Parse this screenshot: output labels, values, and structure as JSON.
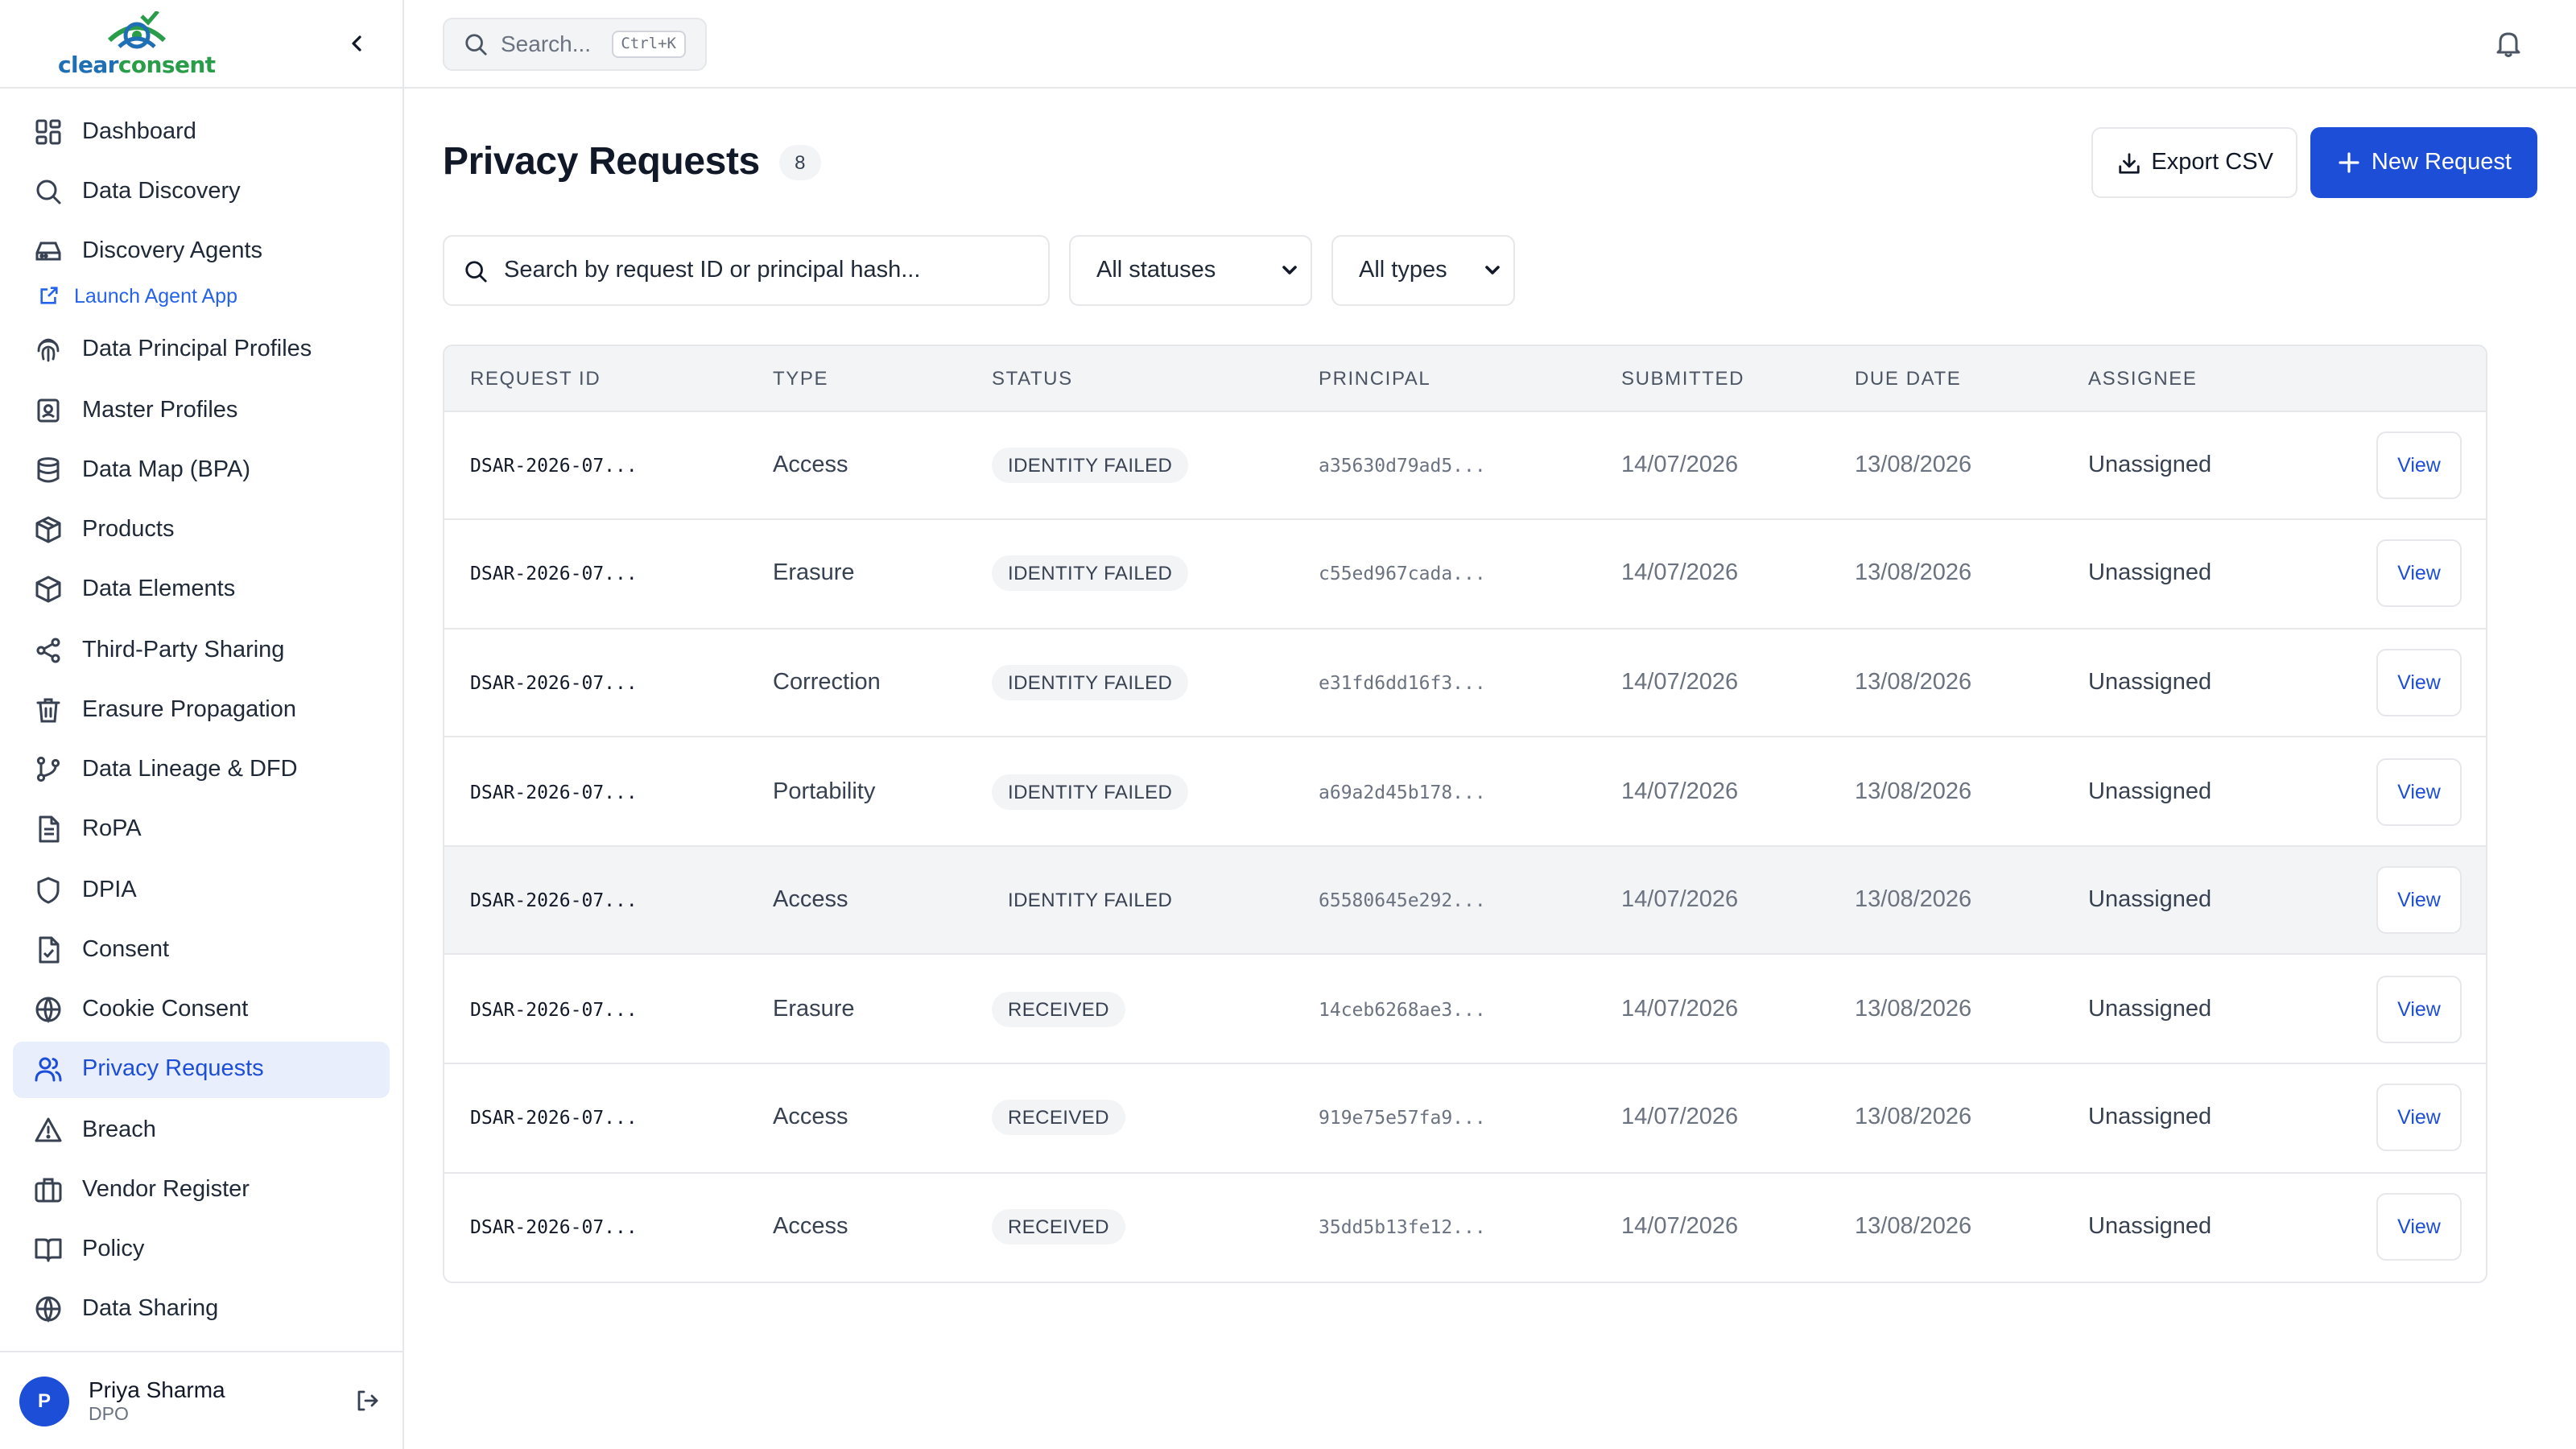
{
  "brand": {
    "name_part1": "clear",
    "name_part2": "consent",
    "primary": "#1d4ed8"
  },
  "sidebar": {
    "items": [
      {
        "label": "Dashboard",
        "icon": "dashboard-icon"
      },
      {
        "label": "Data Discovery",
        "icon": "search-icon"
      },
      {
        "label": "Discovery Agents",
        "icon": "hard-drive-icon"
      },
      {
        "label": "Data Principal Profiles",
        "icon": "fingerprint-icon"
      },
      {
        "label": "Master Profiles",
        "icon": "contact-icon"
      },
      {
        "label": "Data Map (BPA)",
        "icon": "database-icon"
      },
      {
        "label": "Products",
        "icon": "package-icon"
      },
      {
        "label": "Data Elements",
        "icon": "box-icon"
      },
      {
        "label": "Third-Party Sharing",
        "icon": "share-icon"
      },
      {
        "label": "Erasure Propagation",
        "icon": "trash-icon"
      },
      {
        "label": "Data Lineage & DFD",
        "icon": "git-branch-icon"
      },
      {
        "label": "RoPA",
        "icon": "file-text-icon"
      },
      {
        "label": "DPIA",
        "icon": "shield-icon"
      },
      {
        "label": "Consent",
        "icon": "file-check-icon"
      },
      {
        "label": "Cookie Consent",
        "icon": "globe-icon"
      },
      {
        "label": "Privacy Requests",
        "icon": "users-icon"
      },
      {
        "label": "Breach",
        "icon": "alert-triangle-icon"
      },
      {
        "label": "Vendor Register",
        "icon": "briefcase-icon"
      },
      {
        "label": "Policy",
        "icon": "book-icon"
      },
      {
        "label": "Data Sharing",
        "icon": "globe-icon"
      }
    ],
    "launch_agent_label": "Launch Agent App",
    "user": {
      "initial": "P",
      "name": "Priya Sharma",
      "role": "DPO"
    }
  },
  "topbar": {
    "search_label": "Search...",
    "shortcut": "Ctrl+K"
  },
  "page": {
    "title": "Privacy Requests",
    "count": "8",
    "export_label": "Export CSV",
    "new_label": "New Request"
  },
  "filters": {
    "search_placeholder": "Search by request ID or principal hash...",
    "status_selected": "All statuses",
    "type_selected": "All types"
  },
  "table": {
    "columns": [
      "REQUEST ID",
      "TYPE",
      "STATUS",
      "PRINCIPAL",
      "SUBMITTED",
      "DUE DATE",
      "ASSIGNEE"
    ],
    "action_label": "View",
    "rows": [
      {
        "id": "DSAR-2026-07...",
        "type": "Access",
        "status": "IDENTITY FAILED",
        "principal": "a35630d79ad5...",
        "submitted": "14/07/2026",
        "due": "13/08/2026",
        "assignee": "Unassigned"
      },
      {
        "id": "DSAR-2026-07...",
        "type": "Erasure",
        "status": "IDENTITY FAILED",
        "principal": "c55ed967cada...",
        "submitted": "14/07/2026",
        "due": "13/08/2026",
        "assignee": "Unassigned"
      },
      {
        "id": "DSAR-2026-07...",
        "type": "Correction",
        "status": "IDENTITY FAILED",
        "principal": "e31fd6dd16f3...",
        "submitted": "14/07/2026",
        "due": "13/08/2026",
        "assignee": "Unassigned"
      },
      {
        "id": "DSAR-2026-07...",
        "type": "Portability",
        "status": "IDENTITY FAILED",
        "principal": "a69a2d45b178...",
        "submitted": "14/07/2026",
        "due": "13/08/2026",
        "assignee": "Unassigned"
      },
      {
        "id": "DSAR-2026-07...",
        "type": "Access",
        "status": "IDENTITY FAILED",
        "principal": "65580645e292...",
        "submitted": "14/07/2026",
        "due": "13/08/2026",
        "assignee": "Unassigned"
      },
      {
        "id": "DSAR-2026-07...",
        "type": "Erasure",
        "status": "RECEIVED",
        "principal": "14ceb6268ae3...",
        "submitted": "14/07/2026",
        "due": "13/08/2026",
        "assignee": "Unassigned"
      },
      {
        "id": "DSAR-2026-07...",
        "type": "Access",
        "status": "RECEIVED",
        "principal": "919e75e57fa9...",
        "submitted": "14/07/2026",
        "due": "13/08/2026",
        "assignee": "Unassigned"
      },
      {
        "id": "DSAR-2026-07...",
        "type": "Access",
        "status": "RECEIVED",
        "principal": "35dd5b13fe12...",
        "submitted": "14/07/2026",
        "due": "13/08/2026",
        "assignee": "Unassigned"
      }
    ]
  }
}
